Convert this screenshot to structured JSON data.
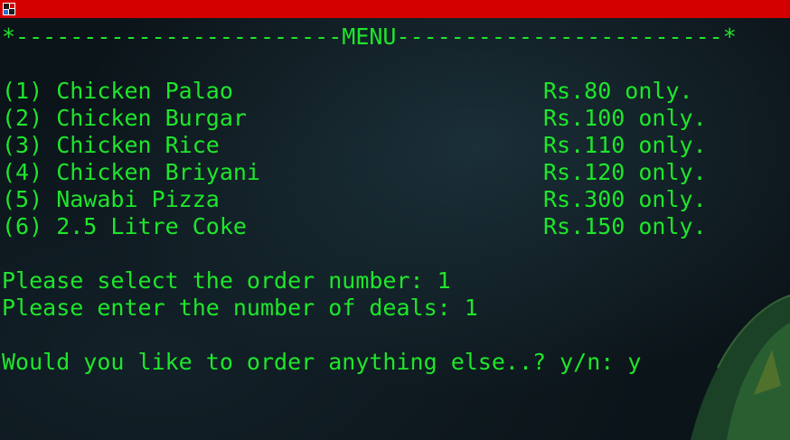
{
  "window": {
    "icon": "terminal-app-icon"
  },
  "console": {
    "header": "*------------------------MENU------------------------*",
    "items": [
      {
        "label": "(1) Chicken Palao",
        "price": "Rs.80 only."
      },
      {
        "label": "(2) Chicken Burgar",
        "price": "Rs.100 only."
      },
      {
        "label": "(3) Chicken Rice",
        "price": "Rs.110 only."
      },
      {
        "label": "(4) Chicken Briyani",
        "price": "Rs.120 only."
      },
      {
        "label": "(5) Nawabi Pizza",
        "price": "Rs.300 only."
      },
      {
        "label": "(6) 2.5 Litre Coke",
        "price": "Rs.150 only."
      }
    ],
    "prompt_order": "Please select the order number: 1",
    "prompt_deals": "Please enter the number of deals: 1",
    "prompt_more": "Would you like to order anything else..? y/n: y"
  },
  "colors": {
    "text": "#1ee62b",
    "titlebar": "#d40000",
    "background": "#0b1419"
  }
}
